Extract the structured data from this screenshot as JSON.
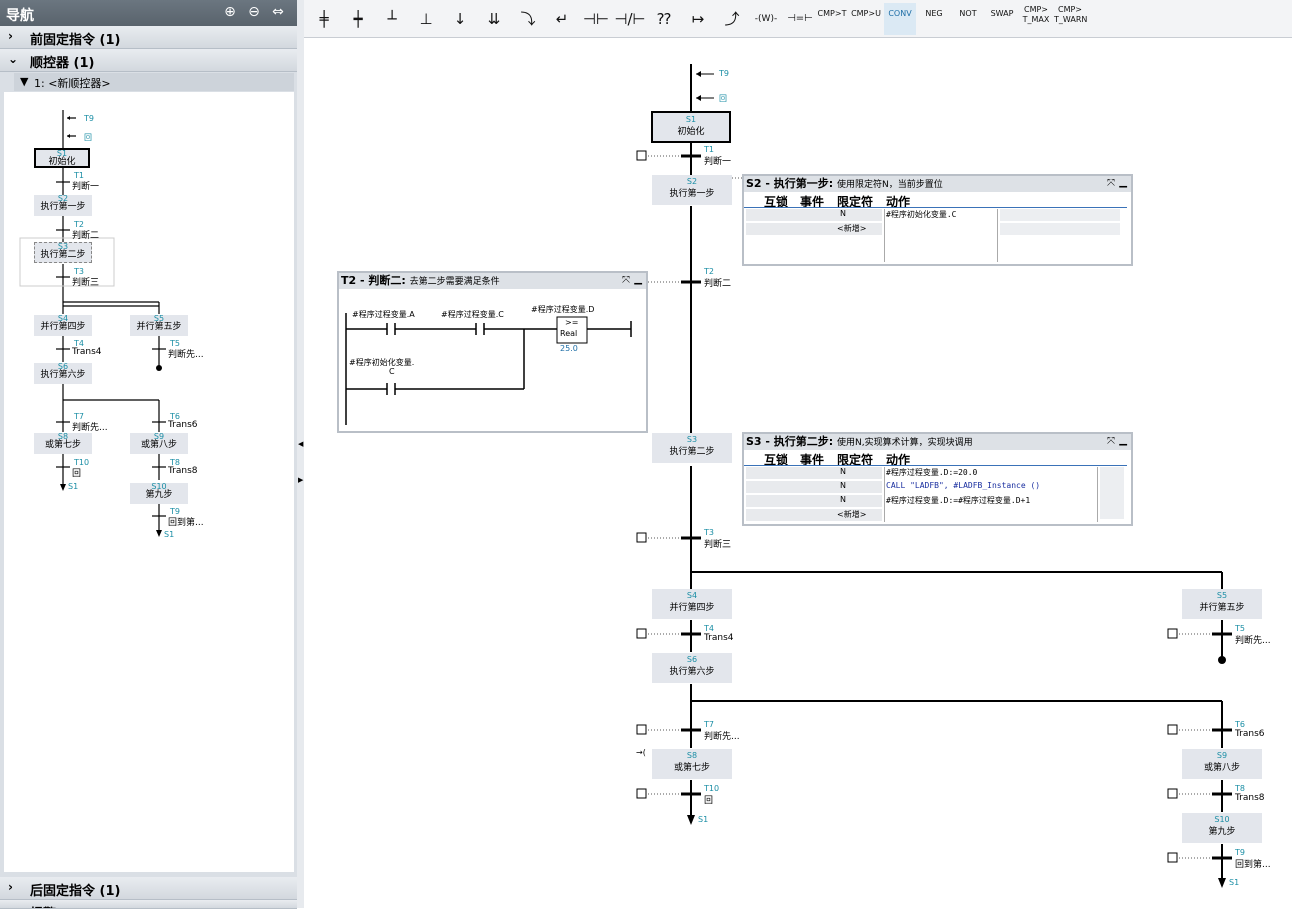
{
  "nav": {
    "title": "导航",
    "sections": {
      "fixed_before": "前固定指令 (1)",
      "sequencer": "顺控器 (1)",
      "fixed_after": "后固定指令 (1)",
      "partial": "报警"
    },
    "tree_head": "1: <新顺控器>",
    "tree": {
      "t9": "T9",
      "t10": "回",
      "s1n": "S1",
      "s1": "初始化",
      "t1n": "T1",
      "t1": "判断一",
      "s2n": "S2",
      "s2": "执行第一步",
      "t2n": "T2",
      "t2": "判断二",
      "s3n": "S3",
      "s3": "执行第二步",
      "t3n": "T3",
      "t3": "判断三",
      "s4n": "S4",
      "s4": "并行第四步",
      "s5n": "S5",
      "s5": "并行第五步",
      "t4n": "T4",
      "t4": "Trans4",
      "t5n": "T5",
      "t5": "判断先...",
      "s6n": "S6",
      "s6": "执行第六步",
      "t7n": "T7",
      "t7": "判断先...",
      "t6n": "T6",
      "t6": "Trans6",
      "s8n": "S8",
      "s8": "或第七步",
      "s9n": "S9",
      "s9": "或第八步",
      "t10n": "T10",
      "t8n": "T8",
      "t8": "Trans8",
      "s1end": "S1",
      "s10n": "S10",
      "s10": "第九步",
      "t9n": "T9",
      "t9b": "回到第...",
      "s1end2": "S1"
    }
  },
  "toolbar": {
    "items": [
      "CMP>T",
      "CMP>U",
      "CONV",
      "NEG",
      "NOT",
      "SWAP",
      "CMP>\nT_MAX",
      "CMP>\nT_WARN"
    ],
    "cmp_t": "CMP>T",
    "cmp_u": "CMP>U",
    "conv": "CONV",
    "neg": "NEG",
    "not": "NOT",
    "swap": "SWAP",
    "cmp_tmax_1": "CMP>",
    "cmp_tmax_2": "T_MAX",
    "cmp_twarn_1": "CMP>",
    "cmp_twarn_2": "T_WARN"
  },
  "graph": {
    "t9": "T9",
    "t10": "回",
    "s1n": "S1",
    "s1": "初始化",
    "t1n": "T1",
    "t1": "判断一",
    "s2n": "S2",
    "s2": "执行第一步",
    "t2n": "T2",
    "t2": "判断二",
    "s3n": "S3",
    "s3": "执行第二步",
    "t3n": "T3",
    "t3": "判断三",
    "s4n": "S4",
    "s4": "并行第四步",
    "s5n": "S5",
    "s5": "并行第五步",
    "t4n": "T4",
    "t4": "Trans4",
    "t5n": "T5",
    "t5": "判断先...",
    "s6n": "S6",
    "s6": "执行第六步",
    "t7n": "T7",
    "t7": "判断先...",
    "t6n": "T6",
    "t6": "Trans6",
    "s8n": "S8",
    "s8": "或第七步",
    "s9n": "S9",
    "s9": "或第八步",
    "t10n": "T10",
    "t8n": "T8",
    "t8": "Trans8",
    "s1end": "S1",
    "s10n": "S10",
    "s10": "第九步",
    "t9n": "T9",
    "t9b": "回到第...",
    "s1end2": "S1"
  },
  "popup_s2": {
    "title": "S2 - 执行第一步:",
    "subtitle": "使用限定符N，当前步置位",
    "cols": [
      "互锁",
      "事件",
      "限定符",
      "动作"
    ],
    "rows": [
      {
        "q": "N",
        "action": "#程序初始化变量.C"
      },
      {
        "q": "<新增>",
        "action": ""
      }
    ]
  },
  "popup_t2": {
    "title": "T2 - 判断二:",
    "subtitle": "去第二步需要满足条件",
    "c1": "#程序过程变量.A",
    "c2": "#程序过程变量.C",
    "c3": "#程序过程变量.D",
    "cmp_op": ">=",
    "cmp_type": "Real",
    "cmp_val": "25.0",
    "c4a": "#程序初始化变量.",
    "c4b": "C"
  },
  "popup_s3": {
    "title": "S3 - 执行第二步:",
    "subtitle": "使用N,实现算术计算，实现块调用",
    "cols": [
      "互锁",
      "事件",
      "限定符",
      "动作"
    ],
    "rows": [
      {
        "q": "N",
        "action": "#程序过程变量.D:=20.0"
      },
      {
        "q": "N",
        "action": "CALL \"LADFB\", #LADFB_Instance ()"
      },
      {
        "q": "N",
        "action": "#程序过程变量.D:=#程序过程变量.D+1"
      },
      {
        "q": "<新增>",
        "action": ""
      }
    ]
  },
  "colors": {
    "accent": "#1b8ea5",
    "nav_bg": "#dadfe5",
    "step_bg": "#e3e6ec"
  }
}
